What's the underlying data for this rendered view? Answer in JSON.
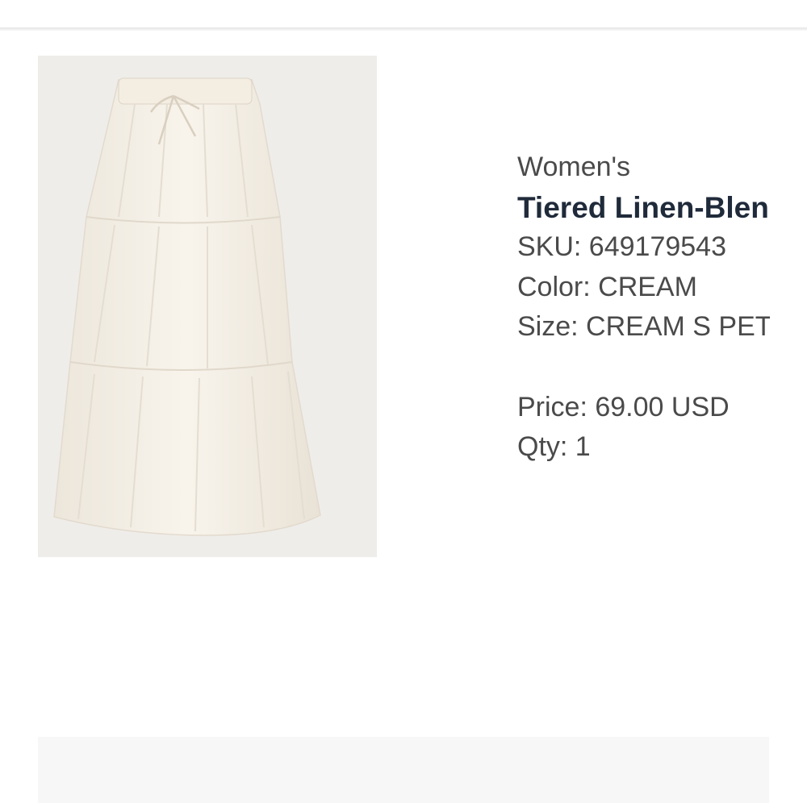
{
  "product": {
    "category": "Women's",
    "name": "Tiered Linen-Blend Maxi Skirt",
    "sku_label": "SKU: 649179543",
    "color_label": "Color: CREAM",
    "size_label": "Size: CREAM S PETITE",
    "price_label": "Price: 69.00 USD",
    "qty_label": "Qty: 1",
    "image_icon": "cream-tiered-maxi-skirt-photo"
  },
  "colors": {
    "title_text": "#1f2a3a",
    "body_text": "#4a4a4a",
    "image_bg": "#efedea",
    "skirt": "#f6f1e8"
  }
}
